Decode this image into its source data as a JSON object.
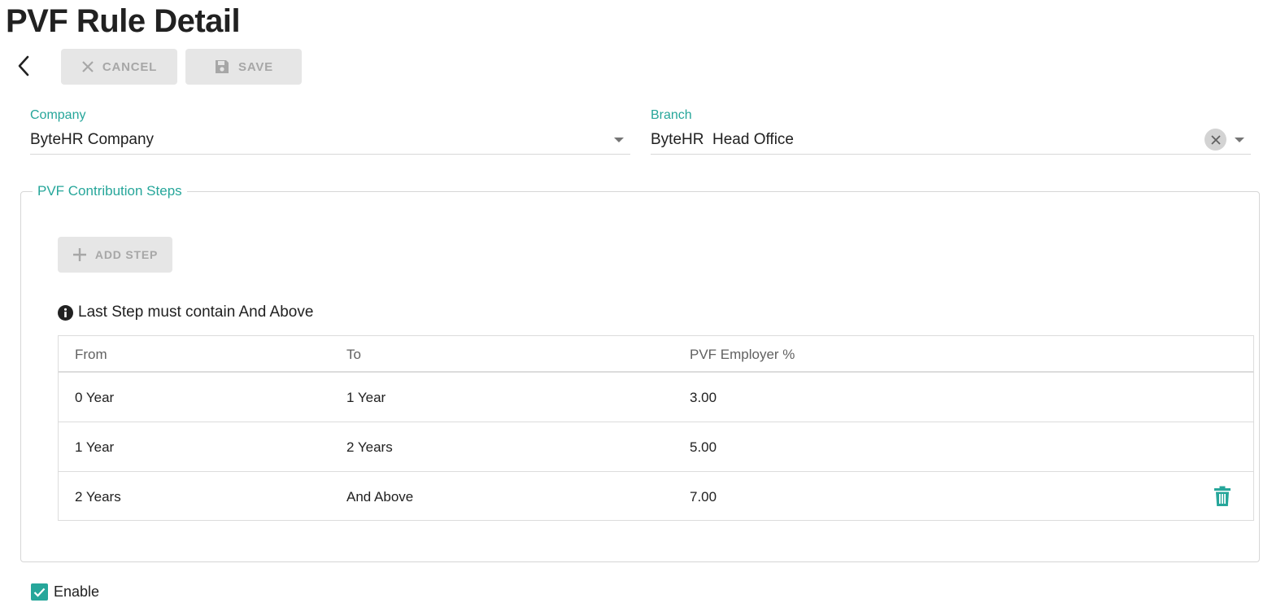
{
  "page": {
    "title": "PVF Rule Detail"
  },
  "toolbar": {
    "back_icon": "chevron-left-icon",
    "cancel_label": "CANCEL",
    "save_label": "SAVE"
  },
  "company": {
    "label": "Company",
    "value": "ByteHR Company"
  },
  "branch": {
    "label": "Branch",
    "value": "ByteHR  Head Office"
  },
  "steps": {
    "legend": "PVF Contribution Steps",
    "add_label": "ADD STEP",
    "note": "Last Step must contain And Above",
    "columns": [
      "From",
      "To",
      "PVF Employer %"
    ],
    "rows": [
      {
        "from": "0 Year",
        "to": "1 Year",
        "pct": "3.00"
      },
      {
        "from": "1 Year",
        "to": "2 Years",
        "pct": "5.00"
      },
      {
        "from": "2 Years",
        "to": "And Above",
        "pct": "7.00"
      }
    ]
  },
  "enable": {
    "label": "Enable",
    "checked": true
  },
  "colors": {
    "accent": "#26a69a",
    "disabled_bg": "#e6e6e6",
    "disabled_text": "#a7a7a7"
  }
}
